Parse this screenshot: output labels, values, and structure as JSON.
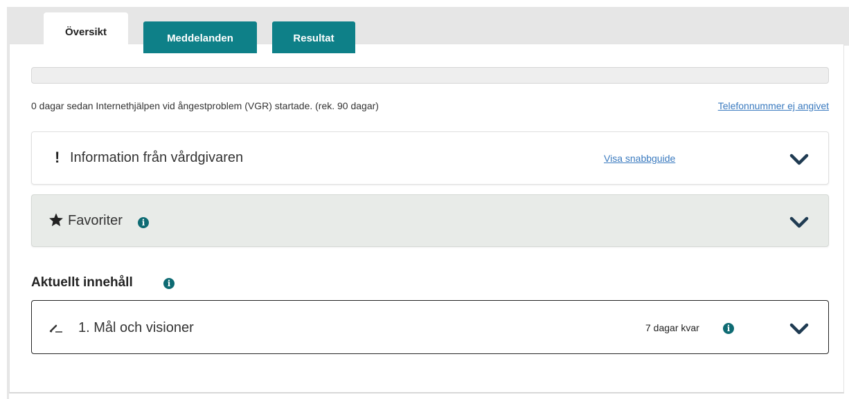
{
  "tabs": [
    {
      "label": "Översikt",
      "active": true
    },
    {
      "label": "Meddelanden",
      "active": false
    },
    {
      "label": "Resultat",
      "active": false
    }
  ],
  "colors": {
    "accent": "#0e8088",
    "link": "#3a7abf",
    "info_icon": "#0e6b73"
  },
  "progress": {
    "days_text": "0 dagar sedan Internethjälpen vid ångestproblem (VGR) startade. (rek. 90 dagar)",
    "fraction": 0
  },
  "phone_link": "Telefonnummer ej angivet",
  "info_card": {
    "icon": "exclamation-icon",
    "title": "Information från vårdgivaren",
    "guide_link": "Visa snabbguide"
  },
  "favorites_card": {
    "icon": "star-icon",
    "title": "Favoriter"
  },
  "current_content": {
    "title": "Aktuellt innehåll",
    "modules": [
      {
        "icon": "pencil-icon",
        "title": "1. Mål och visioner",
        "days_left": "7 dagar kvar"
      }
    ]
  }
}
